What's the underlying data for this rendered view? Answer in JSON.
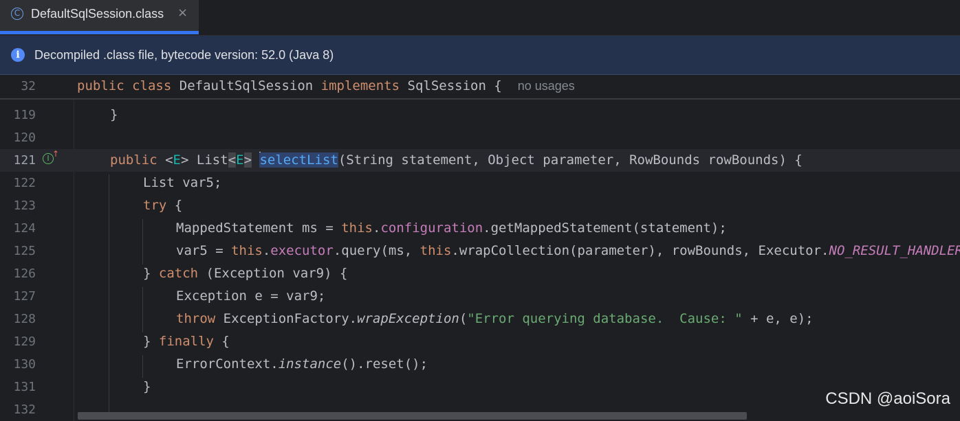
{
  "tab": {
    "label": "DefaultSqlSession.class",
    "close": "×",
    "icon": "class-icon"
  },
  "banner": {
    "icon": "info-icon",
    "text": "Decompiled .class file, bytecode version: 52.0 (Java 8)"
  },
  "sticky": {
    "line_number": "32",
    "hint": "no usages"
  },
  "line_numbers": [
    "119",
    "120",
    "121",
    "122",
    "123",
    "124",
    "125",
    "126",
    "127",
    "128",
    "129",
    "130",
    "131",
    "132"
  ],
  "code": {
    "sticky": {
      "kw_public": "public",
      "kw_class": "class",
      "class_name": "DefaultSqlSession",
      "kw_implements": "implements",
      "iface": "SqlSession",
      "brace": "{"
    },
    "l119": "}",
    "l121": {
      "public": "public",
      "gen_open": "<",
      "gen_E": "E",
      "gen_close": ">",
      "list": "List",
      "lt": "<",
      "E2": "E",
      "gt": ">",
      "method": "selectList",
      "params": "(String statement, Object parameter, RowBounds rowBounds) {"
    },
    "l122": "List var5;",
    "l123": {
      "try": "try",
      "brace": " {"
    },
    "l124": {
      "pre": "MappedStatement ms = ",
      "this": "this",
      "dot": ".",
      "field": "configuration",
      "post": ".getMappedStatement(statement);"
    },
    "l125": {
      "pre": "var5 = ",
      "this1": "this",
      "dot1": ".",
      "field": "executor",
      "mid": ".query(ms, ",
      "this2": "this",
      "mid2": ".wrapCollection(parameter), rowBounds, Executor.",
      "const": "NO_RESULT_HANDLER);"
    },
    "l126": {
      "close": "} ",
      "catch": "catch",
      "rest": " (Exception var9) {"
    },
    "l127": "Exception e = var9;",
    "l128": {
      "throw": "throw",
      "pre": " ExceptionFactory.",
      "method": "wrapException",
      "open": "(",
      "str": "\"Error querying database.  Cause: \"",
      "post": " + e, e);"
    },
    "l129": {
      "close": "} ",
      "finally": "finally",
      "brace": " {"
    },
    "l130": {
      "pre": "ErrorContext.",
      "method": "instance",
      "post": "().reset();"
    },
    "l131": "}"
  },
  "watermark": "CSDN @aoiSora",
  "colors": {
    "accent": "#3574f0",
    "background": "#1e1f22",
    "banner": "#25324d"
  }
}
